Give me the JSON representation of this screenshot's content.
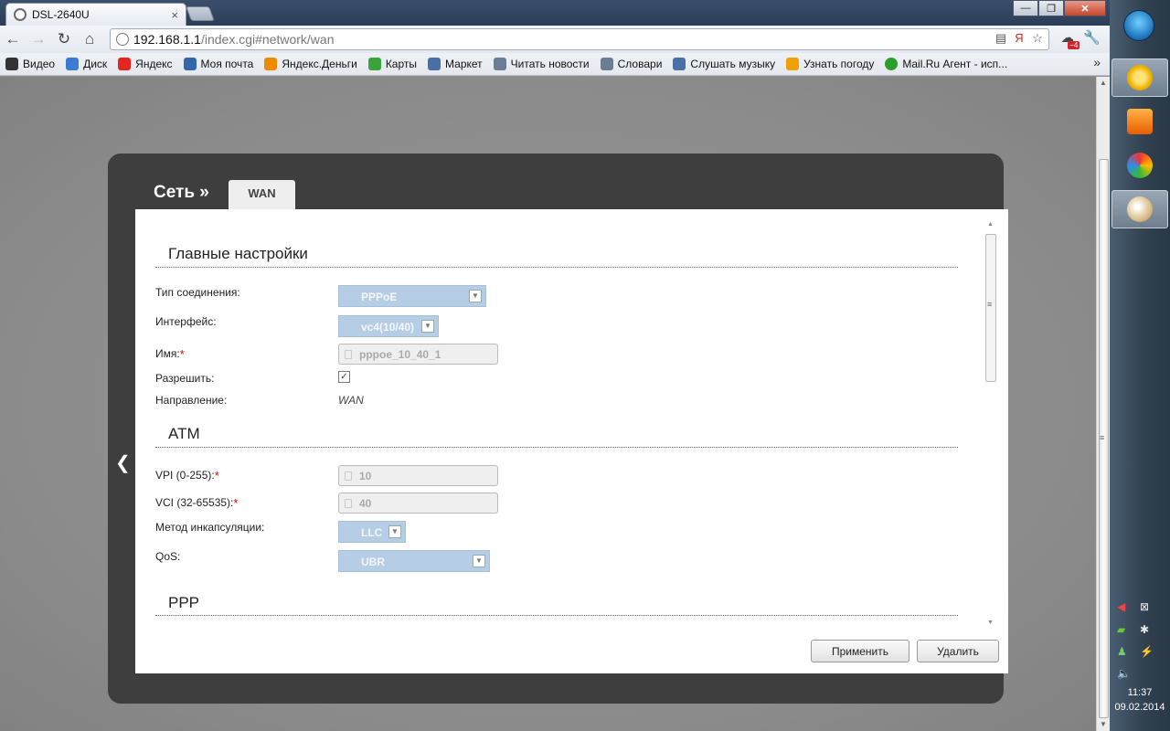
{
  "browser": {
    "tab_title": "DSL-2640U",
    "tab_close": "×",
    "url_host": "192.168.1.1",
    "url_path": "/index.cgi#network/wan",
    "window_buttons": {
      "minimize": "—",
      "maximize": "❐",
      "close": "✕"
    },
    "nav": {
      "back": "←",
      "forward": "→",
      "reload": "↻",
      "home": "⌂"
    },
    "ext_badge": "−4",
    "bookmarks_more": "»",
    "bookmarks": [
      {
        "label": "Видео",
        "color": "#333333"
      },
      {
        "label": "Диск",
        "color": "#3a7bd5"
      },
      {
        "label": "Яндекс",
        "color": "#e52620"
      },
      {
        "label": "Моя почта",
        "color": "#3366aa"
      },
      {
        "label": "Яндекс.Деньги",
        "color": "#f08a00"
      },
      {
        "label": "Карты",
        "color": "#3aa33a"
      },
      {
        "label": "Маркет",
        "color": "#4a6fa5"
      },
      {
        "label": "Читать новости",
        "color": "#6b7d95"
      },
      {
        "label": "Словари",
        "color": "#6b7d95"
      },
      {
        "label": "Слушать музыку",
        "color": "#4a6fa5"
      },
      {
        "label": "Узнать погоду",
        "color": "#f0a000"
      },
      {
        "label": "Mail.Ru Агент - исп...",
        "color": "#2aa02a"
      }
    ]
  },
  "router": {
    "breadcrumb": "Сеть »",
    "active_tab": "WAN",
    "back_arrow": "❮",
    "sections": {
      "main": "Главные настройки",
      "atm": "ATM",
      "ppp": "PPP"
    },
    "fields": {
      "conn_type_label": "Тип соединения:",
      "conn_type_value": "PPPoE",
      "interface_label": "Интерфейс:",
      "interface_value": "vc4(10/40)",
      "name_label": "Имя:",
      "name_value": "pppoe_10_40_1",
      "enable_label": "Разрешить:",
      "enable_checked": "✓",
      "direction_label": "Направление:",
      "direction_value": "WAN",
      "vpi_label": "VPI (0-255):",
      "vpi_value": "10",
      "vci_label": "VCI (32-65535):",
      "vci_value": "40",
      "encap_label": "Метод инкапсуляции:",
      "encap_value": "LLC",
      "qos_label": "QoS:",
      "qos_value": "UBR",
      "required_mark": "*"
    },
    "buttons": {
      "apply": "Применить",
      "delete": "Удалить"
    },
    "dropdown_glyph": "▼"
  },
  "taskbar": {
    "time": "11:37",
    "date": "09.02.2014"
  }
}
